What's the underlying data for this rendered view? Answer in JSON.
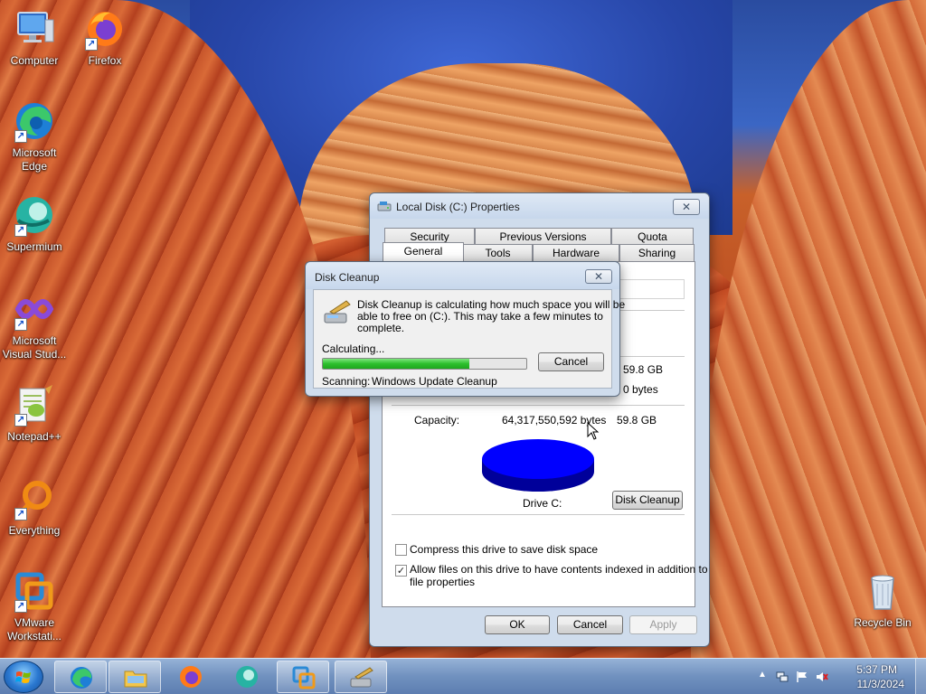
{
  "desktop": {
    "icons": [
      {
        "label": "Computer",
        "icon": "computer-icon"
      },
      {
        "label": "Firefox",
        "icon": "firefox-icon"
      },
      {
        "label": "Microsoft Edge",
        "icon": "edge-icon"
      },
      {
        "label": "Supermium",
        "icon": "supermium-icon"
      },
      {
        "label": "Microsoft Visual Stud...",
        "icon": "visual-studio-icon"
      },
      {
        "label": "Notepad++",
        "icon": "notepadpp-icon"
      },
      {
        "label": "Everything",
        "icon": "everything-icon"
      },
      {
        "label": "VMware Workstati...",
        "icon": "vmware-icon"
      },
      {
        "label": "Recycle Bin",
        "icon": "recycle-bin-icon"
      }
    ]
  },
  "properties": {
    "title": "Local Disk (C:) Properties",
    "close": "✕",
    "tabs_top": [
      "Security",
      "Previous Versions",
      "Quota"
    ],
    "tabs_bottom": [
      "General",
      "Tools",
      "Hardware",
      "Sharing"
    ],
    "active_tab": "General",
    "used_gb": "59.8 GB",
    "free_bytes": "0 bytes",
    "capacity_label": "Capacity:",
    "capacity_bytes": "64,317,550,592 bytes",
    "capacity_gb": "59.8 GB",
    "drive_label": "Drive C:",
    "disk_cleanup_button": "Disk Cleanup",
    "compress_label": "Compress this drive to save disk space",
    "compress_checked": false,
    "index_label_line1": "Allow files on this drive to have contents indexed in addition to",
    "index_label_line2": "file properties",
    "index_checked": true,
    "ok": "OK",
    "cancel": "Cancel",
    "apply": "Apply",
    "pie_color": "#0000ff"
  },
  "disk_cleanup": {
    "title": "Disk Cleanup",
    "close": "✕",
    "message_line1": "Disk Cleanup is calculating how much space you will be",
    "message_line2": "able to free on  (C:). This may take a few minutes to",
    "message_line3": "complete.",
    "calculating": "Calculating...",
    "progress_fraction": 0.72,
    "cancel": "Cancel",
    "scanning_label": "Scanning:",
    "scanning_value": "Windows Update Cleanup"
  },
  "taskbar": {
    "items": [
      "start-button",
      "edge",
      "file-explorer",
      "firefox",
      "supermium",
      "vmware",
      "disk-cleanup"
    ],
    "time": "5:37 PM",
    "date": "11/3/2024"
  }
}
